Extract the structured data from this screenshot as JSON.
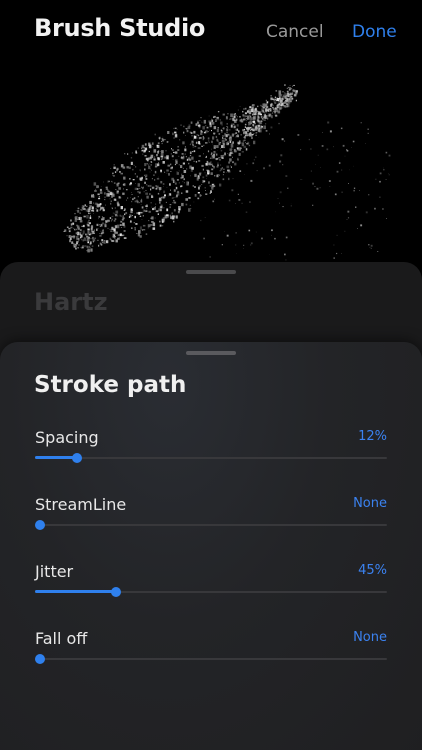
{
  "header": {
    "title": "Brush Studio",
    "cancel_label": "Cancel",
    "done_label": "Done"
  },
  "brush_sheet": {
    "title": "Hartz"
  },
  "stroke_path": {
    "title": "Stroke path",
    "settings": [
      {
        "label": "Spacing",
        "value": "12%",
        "level": 0.12
      },
      {
        "label": "StreamLine",
        "value": "None",
        "level": 0
      },
      {
        "label": "Jitter",
        "value": "45%",
        "level": 0.23
      },
      {
        "label": "Fall off",
        "value": "None",
        "level": 0
      }
    ]
  },
  "colors": {
    "accent": "#2f80ed",
    "background": "#000000",
    "sheet": "#232427"
  }
}
